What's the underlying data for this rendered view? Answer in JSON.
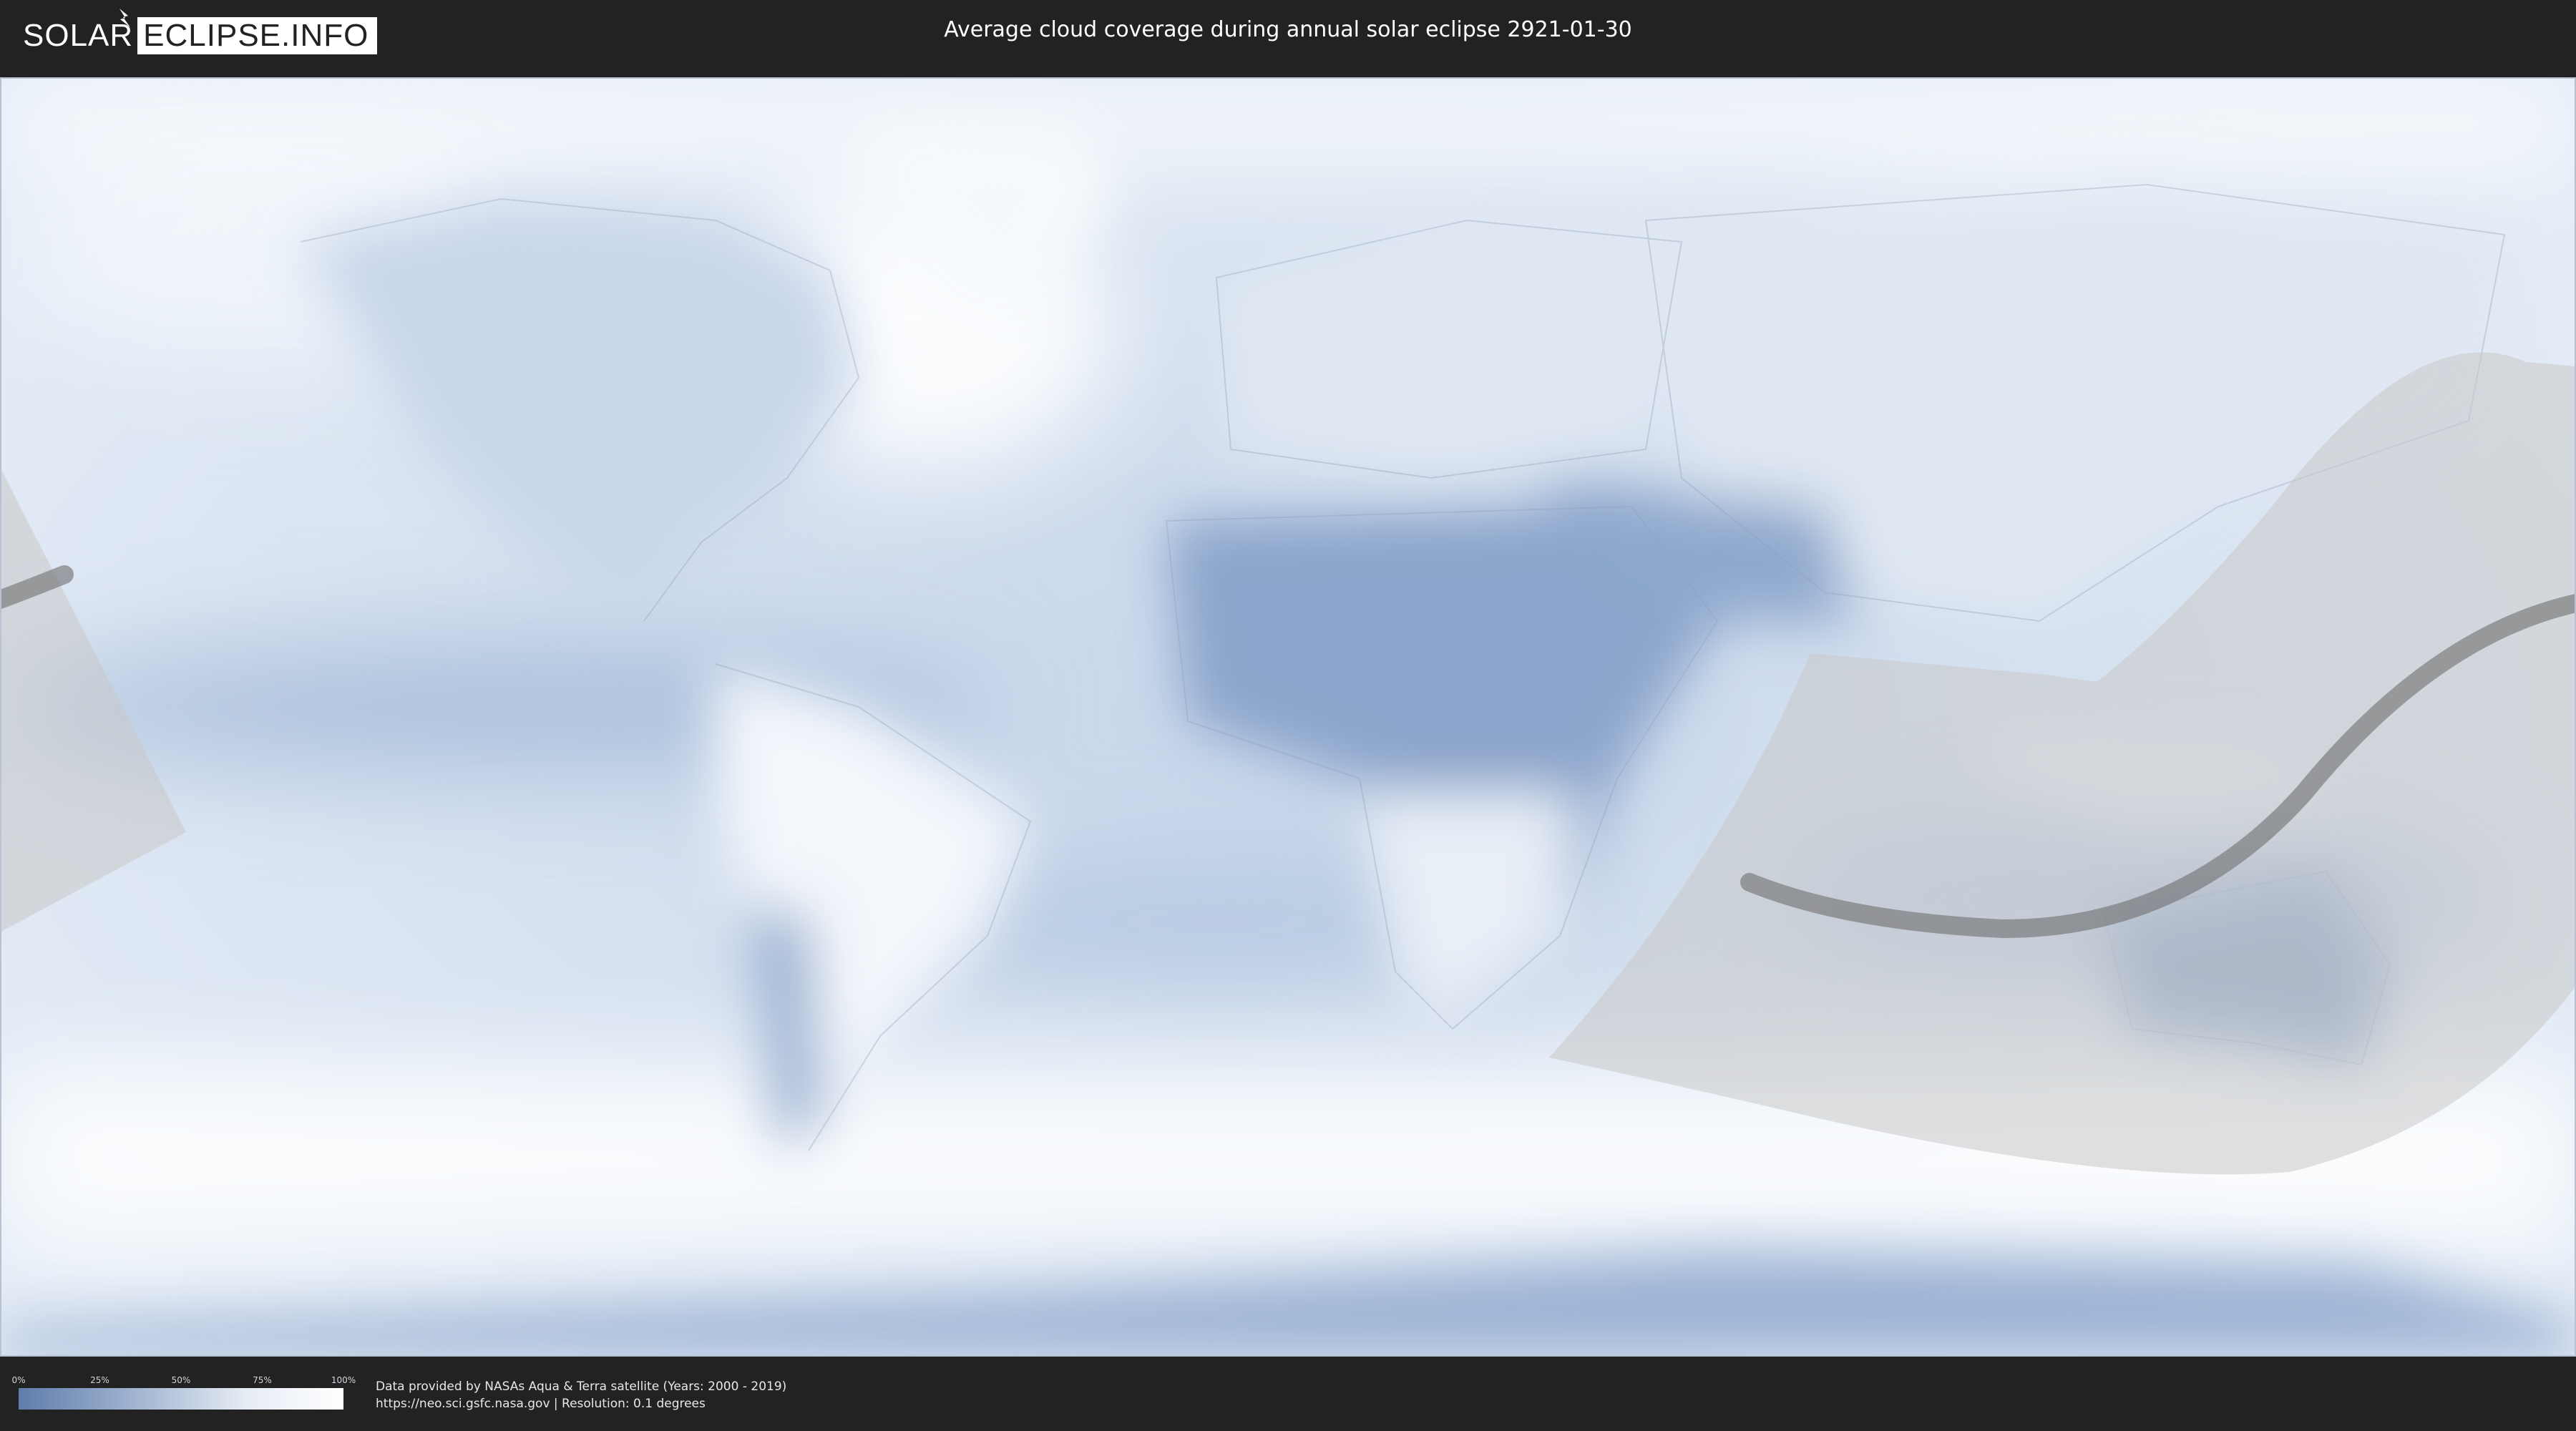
{
  "header": {
    "logo_left": "SOLAR",
    "logo_right": "ECLIPSE.INFO",
    "title": "Average cloud coverage during annual solar eclipse 2921-01-30"
  },
  "legend": {
    "labels": [
      "0%",
      "25%",
      "50%",
      "75%",
      "100%"
    ],
    "values": [
      0,
      25,
      50,
      75,
      100
    ],
    "color_low": "#5f7cab",
    "color_high": "#ffffff"
  },
  "footer": {
    "credit_line_1": "Data provided by NASAs Aqua & Terra satellite (Years: 2000 - 2019)",
    "credit_line_2": "https://neo.sci.gsfc.nasa.gov | Resolution: 0.1 degrees"
  },
  "map": {
    "projection": "equirectangular",
    "cloud_color_low": "#6f8cb8",
    "cloud_color_high": "#ffffff",
    "eclipse_zone_color": "#c8c8c8",
    "eclipse_path_color": "#6e6e6e"
  }
}
